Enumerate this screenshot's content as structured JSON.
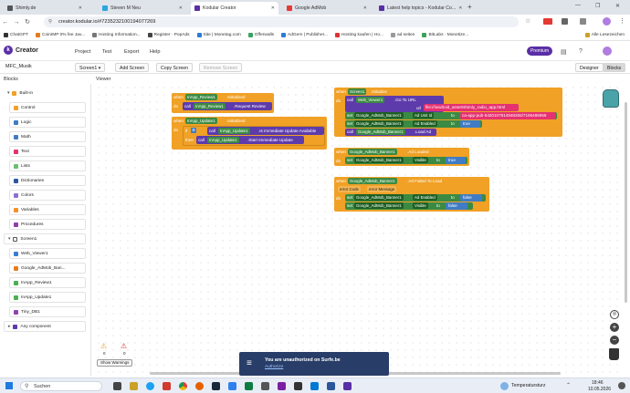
{
  "browser": {
    "tabs": [
      {
        "label": "Shimly.de",
        "color": "#555"
      },
      {
        "label": "Steven M Neu",
        "color": "#2aa6e0"
      },
      {
        "label": "Kodular Creator",
        "color": "#5a2ea6"
      },
      {
        "label": "Google AdMob",
        "color": "#e53935"
      },
      {
        "label": "Latest help topics - Kodular Co...",
        "color": "#5a2ea6"
      }
    ],
    "url": "creator.kodular.io/#7235232100194077269",
    "bookmarks": [
      "ChatGPT",
      "CoinIMP 0% fee Jav...",
      "Hosting Information...",
      "Register · PopAds",
      "Site | Monetag.com",
      "Offerwalls",
      "AdGem | Publisher...",
      "Hosting kaufen | Ho...",
      "ad seiten",
      "BitLabs · Monetize..."
    ],
    "all_bookmarks": "Alle Lesezeichen"
  },
  "app": {
    "logo": "Creator",
    "menu": [
      "Project",
      "Test",
      "Export",
      "Help"
    ],
    "premium": "Premium",
    "project_name": "MFC_Musik",
    "screen_select": "Screen1",
    "add_screen": "Add Screen",
    "copy_screen": "Copy Screen",
    "remove_screen": "Remove Screen",
    "designer": "Designer",
    "blocks_btn": "Blocks",
    "blocks_header": "Blocks",
    "viewer_header": "Viewer"
  },
  "sidebar": {
    "builtin": "Built-in",
    "builtin_items": [
      {
        "label": "Control",
        "color": "#f0a126"
      },
      {
        "label": "Logic",
        "color": "#3f7cc5"
      },
      {
        "label": "Math",
        "color": "#3f7cc5"
      },
      {
        "label": "Text",
        "color": "#e53170"
      },
      {
        "label": "Lists",
        "color": "#6abf6f"
      },
      {
        "label": "Dictionaries",
        "color": "#2d57a0"
      },
      {
        "label": "Colors",
        "color": "#8c6fd0"
      },
      {
        "label": "Variables",
        "color": "#f58f2c"
      },
      {
        "label": "Procedures",
        "color": "#8e3fa8"
      }
    ],
    "screen": "Screen1",
    "components": [
      "Web_Viewer1",
      "Google_AdMob_Ban...",
      "InApp_Review1",
      "InApp_Update1",
      "Tiny_DB1"
    ],
    "any_component": "Any component"
  },
  "blocks": {
    "when": "when",
    "do": "do",
    "call": "call",
    "set": "set",
    "then": "then",
    "if": "if",
    "to": "to",
    "b1_comp": "InApp_Review1",
    "b1_event": ".Initialized",
    "b1_call_comp": "InApp_Review1",
    "b1_call_method": ".Request Review",
    "b2_comp": "InApp_Update1",
    "b2_event": ".Initialized",
    "b2_if_comp": "InApp_Update1",
    "b2_if_method": ".Is Immediate Update Available",
    "b2_call_comp": "InApp_Update1",
    "b2_call_method": ".Start Immediate Update",
    "b3_comp": "Screen1",
    "b3_event": ".Initialize",
    "b3_call_comp": "Web_Viewer1",
    "b3_call_method": ".Go To URL",
    "b3_url_label": "url",
    "b3_url_text": "file:///android_asset/shimly_radio_app.html",
    "b3_set1_comp": "Google_AdMob_Banner1",
    "b3_set1_prop": "Ad Unit Id",
    "b3_set1_val": "ca-app-pub-5420107914948265/7195486959",
    "b3_set2_comp": "Google_AdMob_Banner1",
    "b3_set2_prop": "Ad Enabled",
    "b3_set2_val": "true",
    "b3_call2_comp": "Google_AdMob_Banner1",
    "b3_call2_method": ".Load Ad",
    "b4_comp": "Google_AdMob_Banner1",
    "b4_event": ".Ad Loaded",
    "b4_set_comp": "Google_AdMob_Banner1",
    "b4_set_prop": "Visible",
    "b4_set_val": "true",
    "b5_comp": "Google_AdMob_Banner1",
    "b5_event": ".Ad Failed To Load",
    "b5_param1": "error Code",
    "b5_param2": "error Message",
    "b5_set1_comp": "Google_AdMob_Banner1",
    "b5_set1_prop": "Ad Enabled",
    "b5_set1_val": "false",
    "b5_set2_comp": "Google_AdMob_Banner1",
    "b5_set2_prop": "Visible",
    "b5_set2_val": "false"
  },
  "warnings": {
    "errors": "0",
    "warnings": "0",
    "show_warnings": "Show Warnings"
  },
  "toast": {
    "title": "You are unauthorized on Surfe.be",
    "link": "Authorize"
  },
  "taskbar": {
    "search": "Suchen",
    "weather": "Temperatursturz",
    "time": "18:46",
    "date": "10.05.2026"
  },
  "colors": {
    "accent": "#5a2ea6",
    "event": "#f0a126",
    "call": "#5e3bab",
    "component": "#3b8a43",
    "text_block": "#e53170",
    "logic_true": "#3f7cc5"
  }
}
